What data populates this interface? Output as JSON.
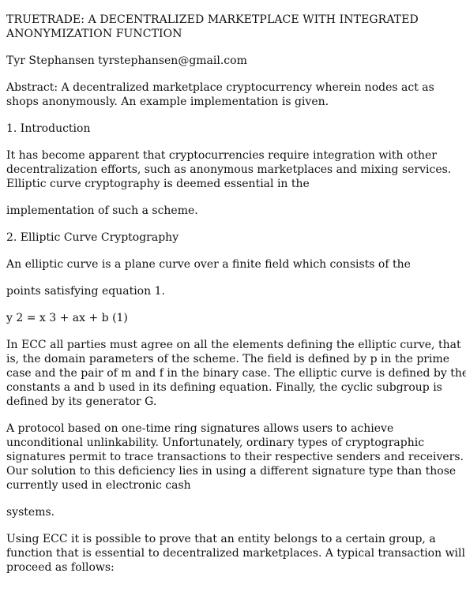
{
  "title": {
    "line1": "TRUETRADE: A DECENTRALIZED MARKETPLACE WITH INTEGRATED",
    "line2": "ANONYMIZATION FUNCTION"
  },
  "author": "Tyr Stephansen tyrstephansen@gmail.com",
  "abstract": {
    "line1": "Abstract: A decentralized marketplace cryptocurrency wherein nodes act as",
    "line2": "shops anonymously. An example implementation is given."
  },
  "sections": [
    {
      "heading": "1. Introduction",
      "paragraphs": [
        {
          "lines": [
            "It has become apparent that cryptocurrencies require integration with other",
            "decentralization efforts, such as anonymous marketplaces and mixing services.",
            "Elliptic curve cryptography is deemed essential in the"
          ]
        },
        {
          "lines": [
            "implementation of such a scheme."
          ]
        }
      ]
    },
    {
      "heading": "2. Elliptic Curve Cryptography",
      "paragraphs": [
        {
          "lines": [
            "An elliptic curve is a plane curve over a finite field which consists of the"
          ]
        },
        {
          "lines": [
            "points satisfying equation 1."
          ]
        },
        {
          "lines": [
            "y 2 = x 3 + ax + b (1)"
          ]
        },
        {
          "lines": [
            "In ECC all parties must agree on all the elements defining the elliptic curve, that",
            "is, the domain parameters of the scheme. The field is defined by p in the prime",
            "case and the pair of m and f in the binary case. The elliptic curve is defined by the",
            "constants a and b used in its defining equation. Finally, the cyclic subgroup is",
            "defined by its generator G."
          ]
        },
        {
          "lines": [
            "A protocol based on one-time ring signatures allows users to achieve",
            "unconditional unlinkability. Unfortunately, ordinary types of cryptographic",
            "signatures permit to trace transactions to their respective senders and receivers.",
            "Our solution to this deficiency lies in using a different signature type than those",
            "currently used in electronic cash"
          ]
        },
        {
          "lines": [
            "systems."
          ]
        },
        {
          "lines": [
            "Using ECC it is possible to prove that an entity belongs to a certain group, a",
            "function that is essential to decentralized marketplaces. A typical transaction will",
            "proceed as follows:"
          ]
        }
      ]
    }
  ]
}
